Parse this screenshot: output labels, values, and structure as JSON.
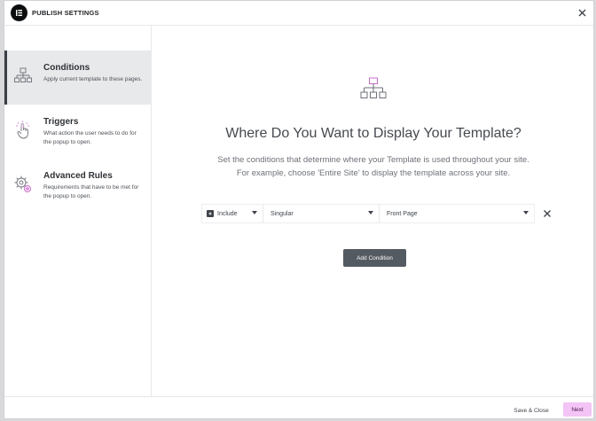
{
  "header": {
    "title": "PUBLISH SETTINGS"
  },
  "sidebar": {
    "items": [
      {
        "title": "Conditions",
        "desc": "Apply current template to these pages.",
        "icon": "sitemap-icon"
      },
      {
        "title": "Triggers",
        "desc": "What action the user needs to do for the popup to open.",
        "icon": "click-pointer-icon"
      },
      {
        "title": "Advanced Rules",
        "desc": "Requirements that have to be met for the popup to open.",
        "icon": "gears-icon"
      }
    ]
  },
  "main": {
    "title": "Where Do You Want to Display Your Template?",
    "desc_line1": "Set the conditions that determine where your Template is used throughout your site.",
    "desc_line2": "For example, choose 'Entire Site' to display the template across your site.",
    "condition": {
      "include": "Include",
      "type": "Singular",
      "page": "Front Page"
    },
    "add_button": "Add Condition"
  },
  "footer": {
    "save_close": "Save & Close",
    "next": "Next"
  },
  "colors": {
    "accent": "#f3c4f5",
    "button_dark": "#545a61"
  }
}
